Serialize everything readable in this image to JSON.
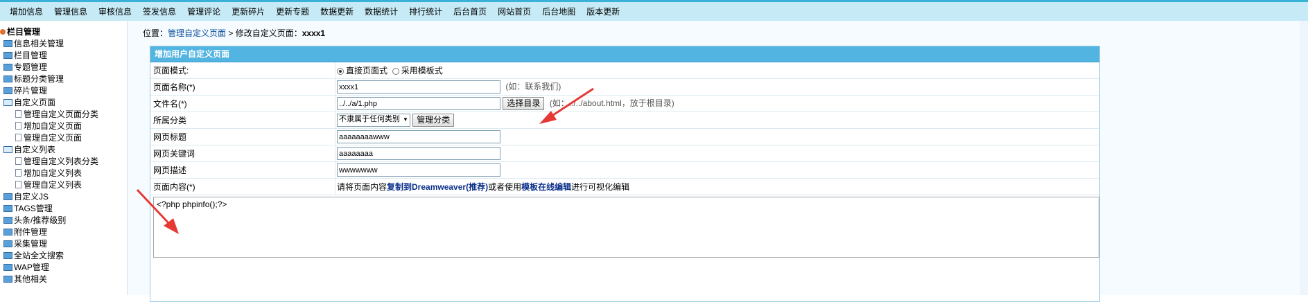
{
  "topmenu": [
    "增加信息",
    "管理信息",
    "审核信息",
    "签发信息",
    "管理评论",
    "更新碎片",
    "更新专题",
    "数据更新",
    "数据统计",
    "排行统计",
    "后台首页",
    "网站首页",
    "后台地图",
    "版本更新"
  ],
  "tree": {
    "root": "栏目管理",
    "items": [
      {
        "label": "信息相关管理",
        "level": 0,
        "kind": "folder"
      },
      {
        "label": "栏目管理",
        "level": 0,
        "kind": "folder"
      },
      {
        "label": "专题管理",
        "level": 0,
        "kind": "folder"
      },
      {
        "label": "标题分类管理",
        "level": 0,
        "kind": "folder"
      },
      {
        "label": "碎片管理",
        "level": 0,
        "kind": "folder"
      },
      {
        "label": "自定义页面",
        "level": 0,
        "kind": "open"
      },
      {
        "label": "管理自定义页面分类",
        "level": 1,
        "kind": "doc"
      },
      {
        "label": "增加自定义页面",
        "level": 1,
        "kind": "doc"
      },
      {
        "label": "管理自定义页面",
        "level": 1,
        "kind": "doc"
      },
      {
        "label": "自定义列表",
        "level": 0,
        "kind": "open"
      },
      {
        "label": "管理自定义列表分类",
        "level": 1,
        "kind": "doc"
      },
      {
        "label": "增加自定义列表",
        "level": 1,
        "kind": "doc"
      },
      {
        "label": "管理自定义列表",
        "level": 1,
        "kind": "doc"
      },
      {
        "label": "自定义JS",
        "level": 0,
        "kind": "folder"
      },
      {
        "label": "TAGS管理",
        "level": 0,
        "kind": "folder"
      },
      {
        "label": "头条/推荐级别",
        "level": 0,
        "kind": "folder"
      },
      {
        "label": "附件管理",
        "level": 0,
        "kind": "folder"
      },
      {
        "label": "采集管理",
        "level": 0,
        "kind": "folder"
      },
      {
        "label": "全站全文搜索",
        "level": 0,
        "kind": "folder"
      },
      {
        "label": "WAP管理",
        "level": 0,
        "kind": "folder"
      },
      {
        "label": "其他相关",
        "level": 0,
        "kind": "folder"
      }
    ]
  },
  "breadcrumb": {
    "prefix": "位置：",
    "link": "管理自定义页面",
    "sep": " > ",
    "current_prefix": "修改自定义页面：",
    "current": "xxxx1"
  },
  "panel": {
    "title": "增加用户自定义页面"
  },
  "form": {
    "mode": {
      "label": "页面模式:",
      "opt1": "直接页面式",
      "opt2": "采用模板式"
    },
    "name": {
      "label": "页面名称(*)",
      "value": "xxxx1",
      "hint": "(如：联系我们)"
    },
    "file": {
      "label": "文件名(*)",
      "value": "../../a/1.php",
      "button": "选择目录",
      "hint": "(如：../../about.html，放于根目录)"
    },
    "category": {
      "label": "所属分类",
      "selected": "不隶属于任何类别",
      "button": "管理分类"
    },
    "title": {
      "label": "网页标题",
      "value": "aaaaaaaawww"
    },
    "keywords": {
      "label": "网页关键词",
      "value": "aaaaaaaa"
    },
    "description": {
      "label": "网页描述",
      "value": "wwwwwww"
    },
    "content": {
      "label": "页面内容(*)",
      "note_a": "请将页面内容",
      "note_link1": "复制到Dreamweaver(推荐)",
      "note_b": "或者使用",
      "note_link2": "模板在线编辑",
      "note_c": "进行可视化编辑",
      "editor_text": "<?php phpinfo();?>"
    }
  },
  "colors": {
    "topbar": "#c6eaf6",
    "panel_head": "#52b4e0",
    "link": "#0a4e9b",
    "arrow": "#e53935"
  }
}
